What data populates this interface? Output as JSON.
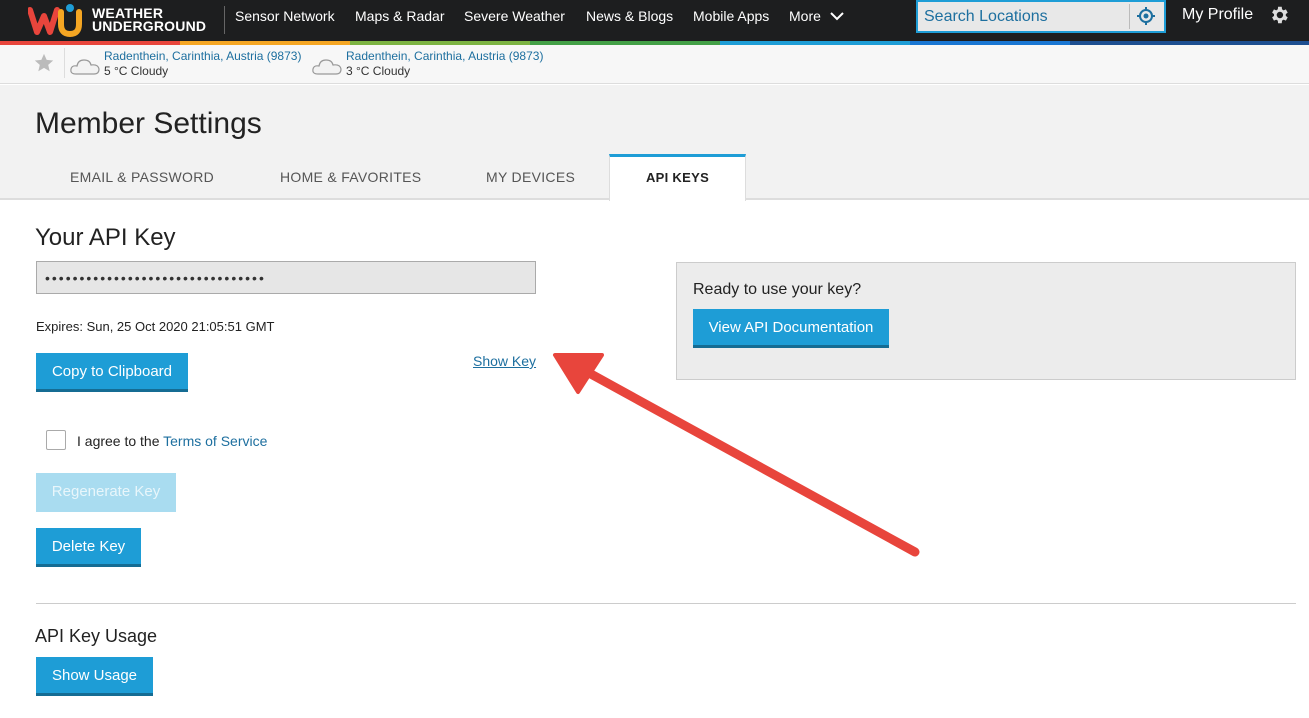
{
  "brand": {
    "line1": "WEATHER",
    "line2": "UNDERGROUND"
  },
  "nav": {
    "items": [
      "Sensor Network",
      "Maps & Radar",
      "Severe Weather",
      "News & Blogs",
      "Mobile Apps",
      "More"
    ],
    "search_placeholder": "Search Locations",
    "profile": "My Profile"
  },
  "colors": {
    "accent": "#1e9dd6",
    "nav_bg": "#1d1e1f",
    "link": "#1d6f9f",
    "annotation_arrow": "#e8453c"
  },
  "favorites": [
    {
      "name": "Radenthein, Carinthia, Austria (9873)",
      "weather": "5 °C Cloudy",
      "icon": "cloud-icon"
    },
    {
      "name": "Radenthein, Carinthia, Austria (9873)",
      "weather": "3 °C Cloudy",
      "icon": "cloud-icon"
    }
  ],
  "page": {
    "title": "Member Settings",
    "tabs": [
      "EMAIL & PASSWORD",
      "HOME & FAVORITES",
      "MY DEVICES",
      "API KEYS"
    ],
    "active_tab": "API KEYS"
  },
  "api": {
    "section_title": "Your API Key",
    "masked_key": "••••••••••••••••••••••••••••••••",
    "expires": "Expires: Sun, 25 Oct 2020 21:05:51 GMT",
    "copy_label": "Copy to Clipboard",
    "show_key_label": "Show Key",
    "agree_prefix": "I agree to the ",
    "terms_label": "Terms of Service",
    "regenerate_label": "Regenerate Key",
    "delete_label": "Delete Key",
    "usage_title": "API Key Usage",
    "usage_label": "Show Usage"
  },
  "panel": {
    "question": "Ready to use your key?",
    "docs_label": "View API Documentation"
  }
}
